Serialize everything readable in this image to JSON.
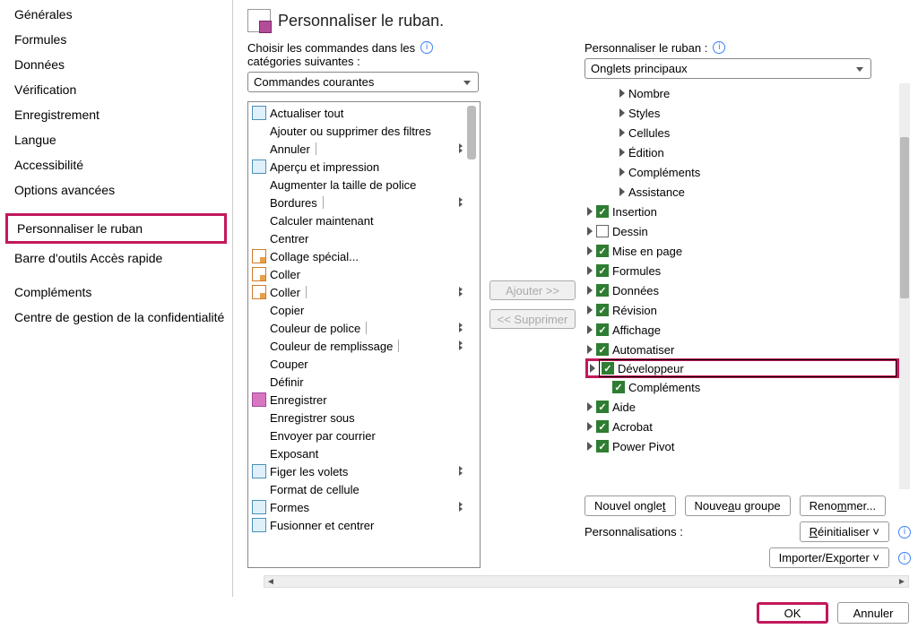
{
  "title": "Personnaliser le ruban.",
  "sidebar": {
    "items": [
      "Générales",
      "Formules",
      "Données",
      "Vérification",
      "Enregistrement",
      "Langue",
      "Accessibilité",
      "Options avancées"
    ],
    "selected": "Personnaliser le ruban",
    "items2": [
      "Barre d'outils Accès rapide"
    ],
    "items3": [
      "Compléments",
      "Centre de gestion de la confidentialité"
    ]
  },
  "left_panel": {
    "label_line1": "Choisir les commandes dans les",
    "label_line2": "catégories suivantes :",
    "select_value": "Commandes courantes",
    "commands": [
      {
        "label": "Actualiser tout",
        "icon": "refresh-icon",
        "split": false
      },
      {
        "label": "Ajouter ou supprimer des filtres",
        "icon": "filter-icon",
        "split": false
      },
      {
        "label": "Annuler",
        "icon": "undo-icon",
        "split": true
      },
      {
        "label": "Aperçu et impression",
        "icon": "print-icon",
        "split": false
      },
      {
        "label": "Augmenter la taille de police",
        "icon": "font-inc-icon",
        "split": false
      },
      {
        "label": "Bordures",
        "icon": "borders-icon",
        "split": true
      },
      {
        "label": "Calculer maintenant",
        "icon": "calc-icon",
        "split": false
      },
      {
        "label": "Centrer",
        "icon": "center-icon",
        "split": false
      },
      {
        "label": "Collage spécial...",
        "icon": "paste-special-icon",
        "split": false
      },
      {
        "label": "Coller",
        "icon": "paste-icon",
        "split": false
      },
      {
        "label": "Coller",
        "icon": "paste-icon",
        "split": true
      },
      {
        "label": "Copier",
        "icon": "copy-icon",
        "split": false
      },
      {
        "label": "Couleur de police",
        "icon": "font-color-icon",
        "split": true
      },
      {
        "label": "Couleur de remplissage",
        "icon": "fill-color-icon",
        "split": true
      },
      {
        "label": "Couper",
        "icon": "cut-icon",
        "split": false
      },
      {
        "label": "Définir",
        "icon": "define-icon",
        "split": false
      },
      {
        "label": "Enregistrer",
        "icon": "save-icon",
        "split": false
      },
      {
        "label": "Enregistrer sous",
        "icon": "save-as-icon",
        "split": false
      },
      {
        "label": "Envoyer par courrier",
        "icon": "mail-icon",
        "split": false
      },
      {
        "label": "Exposant",
        "icon": "superscript-icon",
        "split": false
      },
      {
        "label": "Figer les volets",
        "icon": "freeze-icon",
        "split": "menu"
      },
      {
        "label": "Format de cellule",
        "icon": "format-icon",
        "split": false
      },
      {
        "label": "Formes",
        "icon": "shapes-icon",
        "split": "menu"
      },
      {
        "label": "Fusionner et centrer",
        "icon": "merge-icon",
        "split": false
      }
    ]
  },
  "mid": {
    "add": "Ajouter >>",
    "remove": "<< Supprimer"
  },
  "right_panel": {
    "label": "Personnaliser le ruban :",
    "select_value": "Onglets principaux",
    "top_subs": [
      "Nombre",
      "Styles",
      "Cellules",
      "Édition",
      "Compléments",
      "Assistance"
    ],
    "tabs": [
      {
        "label": "Insertion",
        "checked": true
      },
      {
        "label": "Dessin",
        "checked": false
      },
      {
        "label": "Mise en page",
        "checked": true
      },
      {
        "label": "Formules",
        "checked": true
      },
      {
        "label": "Données",
        "checked": true
      },
      {
        "label": "Révision",
        "checked": true
      },
      {
        "label": "Affichage",
        "checked": true
      },
      {
        "label": "Automatiser",
        "checked": true
      }
    ],
    "highlighted": {
      "label": "Développeur",
      "checked": true
    },
    "sub_item": "Compléments",
    "tabs2": [
      {
        "label": "Aide",
        "checked": true
      },
      {
        "label": "Acrobat",
        "checked": true
      },
      {
        "label": "Power Pivot",
        "checked": true
      }
    ],
    "btn_newtab": "Nouvel onglet",
    "btn_newgroup": "Nouveau groupe",
    "btn_rename": "Renommer...",
    "perso_label": "Personnalisations :",
    "btn_reset": "Réinitialiser",
    "btn_import": "Importer/Exporter"
  },
  "footer": {
    "ok": "OK",
    "cancel": "Annuler"
  }
}
